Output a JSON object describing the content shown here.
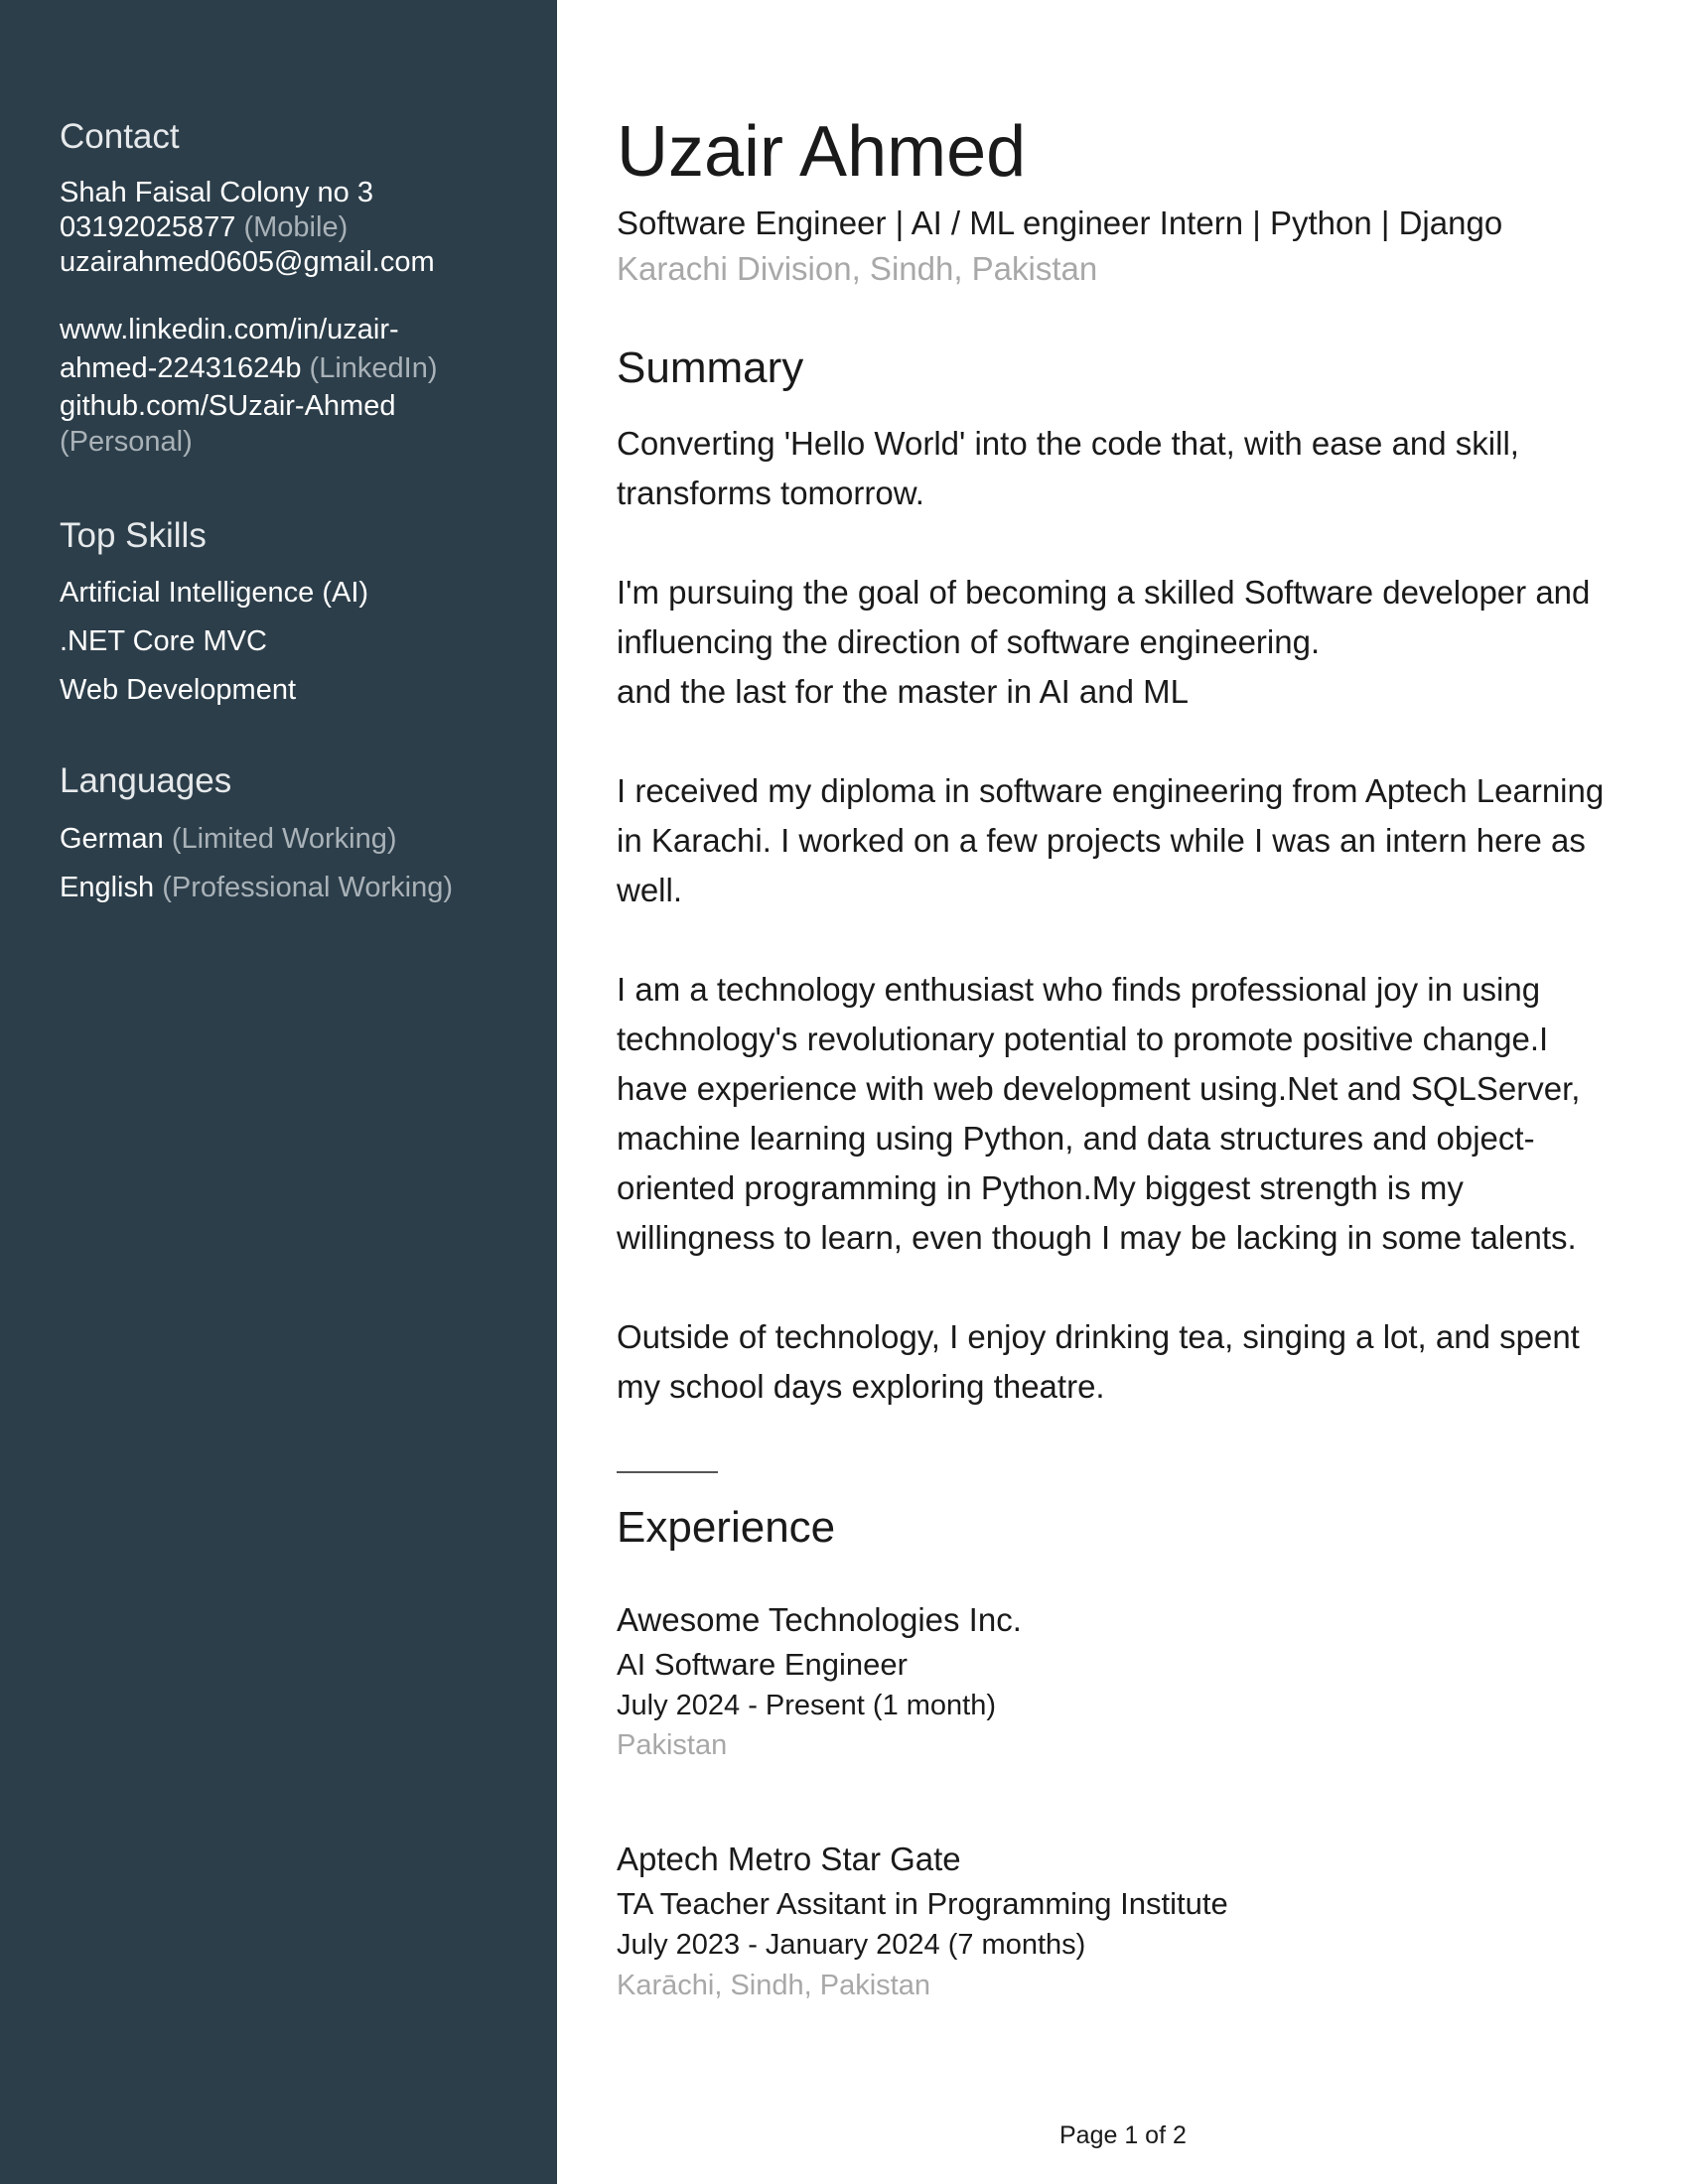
{
  "sidebar": {
    "contact": {
      "heading": "Contact",
      "address": "Shah Faisal Colony no 3",
      "phone": "03192025877",
      "phone_type": "(Mobile)",
      "email": "uzairahmed0605@gmail.com",
      "linkedin_line1": "www.linkedin.com/in/uzair-",
      "linkedin_line2": "ahmed-22431624b",
      "linkedin_type": "(LinkedIn)",
      "github": "github.com/SUzair-Ahmed",
      "github_type": "(Personal)"
    },
    "top_skills": {
      "heading": "Top Skills",
      "items": [
        "Artificial Intelligence (AI)",
        ".NET Core MVC",
        "Web Development"
      ]
    },
    "languages": {
      "heading": "Languages",
      "items": [
        {
          "name": "German",
          "level": "(Limited Working)"
        },
        {
          "name": "English",
          "level": "(Professional Working)"
        }
      ]
    }
  },
  "header": {
    "name": "Uzair Ahmed",
    "headline": "Software Engineer | AI / ML engineer Intern | Python | Django",
    "location": "Karachi Division, Sindh, Pakistan"
  },
  "summary": {
    "heading": "Summary",
    "p1": [
      "Converting 'Hello World' into the code that, with ease and skill,",
      "transforms tomorrow."
    ],
    "p2": [
      "I'm pursuing  the goal of becoming a skilled Software developer and",
      "influencing the direction of software engineering.",
      "and the last for the master in AI and ML"
    ],
    "p3": [
      "I received my diploma in software engineering from Aptech Learning",
      "in Karachi. I worked on a few projects while I was an intern here as",
      "well."
    ],
    "p4": [
      "I am a technology enthusiast who finds professional joy in using",
      "technology's revolutionary potential to promote positive change.I",
      "have experience with web development using.Net and SQLServer,",
      "machine learning using Python, and data structures and object-",
      "oriented programming in Python.My biggest strength is my",
      "willingness to learn, even though I may be lacking in some talents."
    ],
    "p5": [
      "Outside of technology, I enjoy drinking tea, singing a lot, and spent",
      "my school days exploring theatre."
    ]
  },
  "experience": {
    "heading": "Experience",
    "items": [
      {
        "company": "Awesome Technologies Inc.",
        "title": "AI Software Engineer",
        "dates": "July 2024 - Present (1 month)",
        "location": "Pakistan"
      },
      {
        "company": "Aptech Metro Star Gate",
        "title": "TA Teacher Assitant in Programming Institute",
        "dates": "July 2023 - January 2024 (7 months)",
        "location": "Karāchi, Sindh, Pakistan"
      }
    ]
  },
  "footer": {
    "page": "Page 1 of 2"
  },
  "colors": {
    "sidebar_bg": "#2c3e4a",
    "muted_text": "#a8a8a8"
  }
}
